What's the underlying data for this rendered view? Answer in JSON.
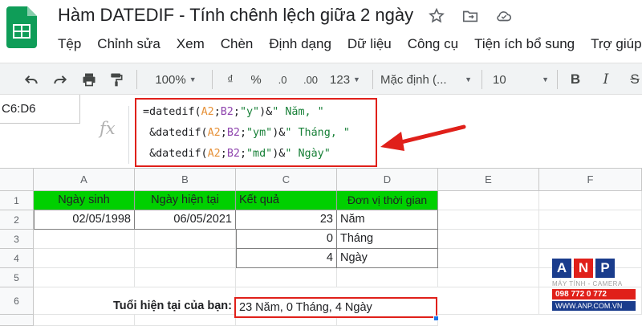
{
  "doc": {
    "title": "Hàm DATEDIF - Tính chênh lệch giữa 2 ngày"
  },
  "menu": [
    "Tệp",
    "Chỉnh sửa",
    "Xem",
    "Chèn",
    "Định dạng",
    "Dữ liệu",
    "Công cụ",
    "Tiện ích bổ sung",
    "Trợ giúp"
  ],
  "toolbar": {
    "zoom": "100%",
    "currency": "₫",
    "percent": "%",
    "dec_decrease": ".0",
    "dec_increase": ".00",
    "more_formats": "123",
    "font": "Mặc định (...",
    "font_size": "10",
    "bold": "B",
    "strike": "S"
  },
  "formula_bar": {
    "name_box": "C6:D6",
    "fx": "fx",
    "line1": {
      "p1": "=datedif(",
      "a2": "A2",
      "sep": ";",
      "b2": "B2",
      "p2": ";",
      "s1": "\"y\"",
      "p3": ")&",
      "s2": "\" Năm, \""
    },
    "line2": {
      "p1": "&datedif(",
      "a2": "A2",
      "sep": ";",
      "b2": "B2",
      "p2": ";",
      "s1": "\"ym\"",
      "p3": ")&",
      "s2": "\" Tháng, \""
    },
    "line3": {
      "p1": "&datedif(",
      "a2": "A2",
      "sep": ";",
      "b2": "B2",
      "p2": ";",
      "s1": "\"md\"",
      "p3": ")&",
      "s2": "\" Ngày\""
    }
  },
  "grid": {
    "columns": [
      "A",
      "B",
      "C",
      "D",
      "E",
      "F"
    ],
    "rows": [
      "1",
      "2",
      "3",
      "4",
      "5",
      "6"
    ],
    "headers": [
      "Ngày sinh",
      "Ngày hiện tại",
      "Kết quả",
      "Đơn vị thời gian"
    ],
    "birth_date": "02/05/1998",
    "current_date": "06/05/2021",
    "results": [
      "23",
      "0",
      "4"
    ],
    "units": [
      "Năm",
      "Tháng",
      "Ngày"
    ],
    "age_label": "Tuổi hiện tại của bạn:",
    "age_value": "23 Năm, 0 Tháng, 4 Ngày"
  },
  "watermark": {
    "letters": [
      "A",
      "N",
      "P"
    ],
    "tagline": "MÁY TÍNH - CAMERA",
    "phone": "098 772 0 772",
    "website": "WWW.ANP.COM.VN"
  },
  "colors": {
    "header_green": "#00d000",
    "highlight_red": "#e0201a",
    "anp_blue": "#1a3c8c"
  }
}
